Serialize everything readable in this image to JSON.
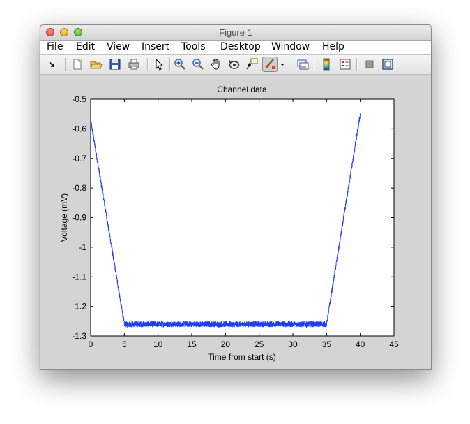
{
  "window": {
    "title": "Figure 1"
  },
  "menu": [
    "File",
    "Edit",
    "View",
    "Insert",
    "Tools",
    "Desktop",
    "Window",
    "Help"
  ],
  "toolbar": {
    "icons": [
      "dock-arrow-icon",
      "new-figure-icon",
      "open-file-icon",
      "save-icon",
      "print-icon",
      "pointer-icon",
      "zoom-in-icon",
      "zoom-out-icon",
      "pan-hand-icon",
      "rotate-3d-icon",
      "data-cursor-icon",
      "brush-icon",
      "brush-dropdown-icon",
      "link-plot-icon",
      "colorbar-icon",
      "legend-icon",
      "hide-plot-tools-icon",
      "show-plot-tools-icon"
    ]
  },
  "chart_data": {
    "type": "line",
    "title": "Channel data",
    "xlabel": "Time from start (s)",
    "ylabel": "Voltage (mV)",
    "xlim": [
      0,
      45
    ],
    "ylim": [
      -1.3,
      -0.5
    ],
    "xticks": [
      0,
      5,
      10,
      15,
      20,
      25,
      30,
      35,
      40,
      45
    ],
    "yticks": [
      -0.5,
      -0.6,
      -0.7,
      -0.8,
      -0.9,
      -1,
      -1.1,
      -1.2,
      -1.3
    ],
    "xtick_labels": [
      "0",
      "5",
      "10",
      "15",
      "20",
      "25",
      "30",
      "35",
      "40",
      "45"
    ],
    "ytick_labels": [
      "-0.5",
      "-0.6",
      "-0.7",
      "-0.8",
      "-0.9",
      "-1",
      "-1.1",
      "-1.2",
      "-1.3"
    ],
    "grid": false,
    "series": [
      {
        "color": "#1f3cff",
        "x": [
          0,
          5,
          35,
          40
        ],
        "y": [
          -0.57,
          -1.26,
          -1.26,
          -0.55
        ],
        "noise_amplitude": 0.01
      }
    ]
  }
}
